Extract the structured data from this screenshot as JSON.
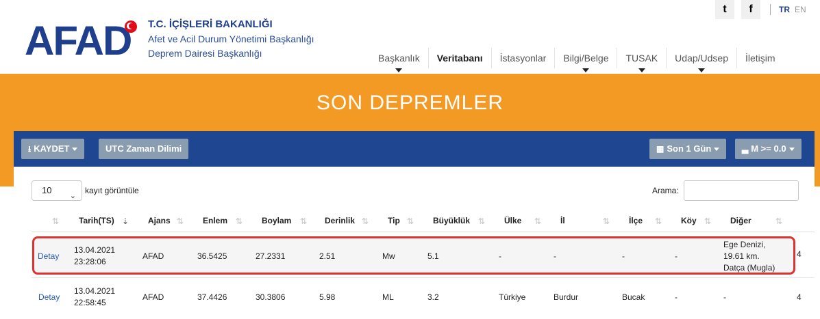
{
  "header": {
    "logo_text": "AFAD",
    "org_line1": "T.C. İÇİŞLERİ BAKANLIĞI",
    "org_line2": "Afet ve Acil Durum Yönetimi Başkanlığı",
    "org_line3": "Deprem Dairesi Başkanlığı",
    "social": [
      "t",
      "f"
    ],
    "lang": {
      "tr": "TR",
      "en": "EN"
    },
    "nav": [
      {
        "label": "Başkanlık",
        "caret": true
      },
      {
        "label": "Veritabanı",
        "caret": false,
        "active": true
      },
      {
        "label": "İstasyonlar",
        "caret": false
      },
      {
        "label": "Bilgi/Belge",
        "caret": true
      },
      {
        "label": "TUSAK",
        "caret": true
      },
      {
        "label": "Udap/Udsep",
        "caret": true
      },
      {
        "label": "İletişim",
        "caret": false
      }
    ]
  },
  "band": {
    "title": "SON DEPREMLER"
  },
  "toolbar": {
    "save": "KAYDET",
    "utc": "UTC Zaman Dilimi",
    "period": "Son 1 Gün",
    "magnitude": "M >= 0.0"
  },
  "controls": {
    "page_length": "10",
    "page_length_label": "kayıt görüntüle",
    "search_label": "Arama:",
    "search_value": ""
  },
  "table": {
    "columns": [
      "Tarih(TS)",
      "Ajans",
      "Enlem",
      "Boylam",
      "Derinlik",
      "Tip",
      "Büyüklük",
      "Ülke",
      "İl",
      "İlçe",
      "Köy",
      "Diğer"
    ],
    "rows": [
      {
        "action": "Detay",
        "date": "13.04.2021",
        "time": "23:28:06",
        "agency": "AFAD",
        "lat": "36.5425",
        "lon": "27.2331",
        "depth": "2.51",
        "type": "Mw",
        "mag": "5.1",
        "country": "-",
        "province": "-",
        "district": "-",
        "village": "-",
        "other1": "Ege Denizi,",
        "other2": "19.61 km.",
        "other3": "Datça (Mugla)",
        "overflow": "4"
      },
      {
        "action": "Detay",
        "date": "13.04.2021",
        "time": "22:58:45",
        "agency": "AFAD",
        "lat": "37.4426",
        "lon": "30.3806",
        "depth": "5.98",
        "type": "ML",
        "mag": "3.2",
        "country": "Türkiye",
        "province": "Burdur",
        "district": "Bucak",
        "village": "-",
        "other1": "-",
        "overflow": "4"
      }
    ]
  },
  "colors": {
    "brand_blue": "#1f3e8c",
    "toolbar_blue": "#1f4690",
    "orange": "#f39a25",
    "highlight_red": "#e03131",
    "link_blue": "#2a5db0"
  }
}
